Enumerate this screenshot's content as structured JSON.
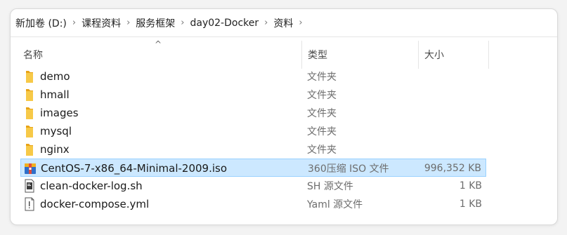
{
  "breadcrumb": [
    "新加卷 (D:)",
    "课程资料",
    "服务框架",
    "day02-Docker",
    "资料"
  ],
  "columns": {
    "name": "名称",
    "type": "类型",
    "size": "大小",
    "sort_indicator": "^"
  },
  "files": [
    {
      "name": "demo",
      "type": "文件夹",
      "size": "",
      "icon": "folder-icon"
    },
    {
      "name": "hmall",
      "type": "文件夹",
      "size": "",
      "icon": "folder-icon"
    },
    {
      "name": "images",
      "type": "文件夹",
      "size": "",
      "icon": "folder-icon"
    },
    {
      "name": "mysql",
      "type": "文件夹",
      "size": "",
      "icon": "folder-icon"
    },
    {
      "name": "nginx",
      "type": "文件夹",
      "size": "",
      "icon": "folder-icon"
    },
    {
      "name": "CentOS-7-x86_64-Minimal-2009.iso",
      "type": "360压缩 ISO 文件",
      "size": "996,352 KB",
      "icon": "archive-icon",
      "selected": true
    },
    {
      "name": "clean-docker-log.sh",
      "type": "SH 源文件",
      "size": "1 KB",
      "icon": "script-file-icon"
    },
    {
      "name": "docker-compose.yml",
      "type": "Yaml 源文件",
      "size": "1 KB",
      "icon": "text-file-icon"
    }
  ],
  "colors": {
    "folder": "#f7c948",
    "selection_bg": "#cce8ff",
    "selection_border": "#99d1ff"
  }
}
